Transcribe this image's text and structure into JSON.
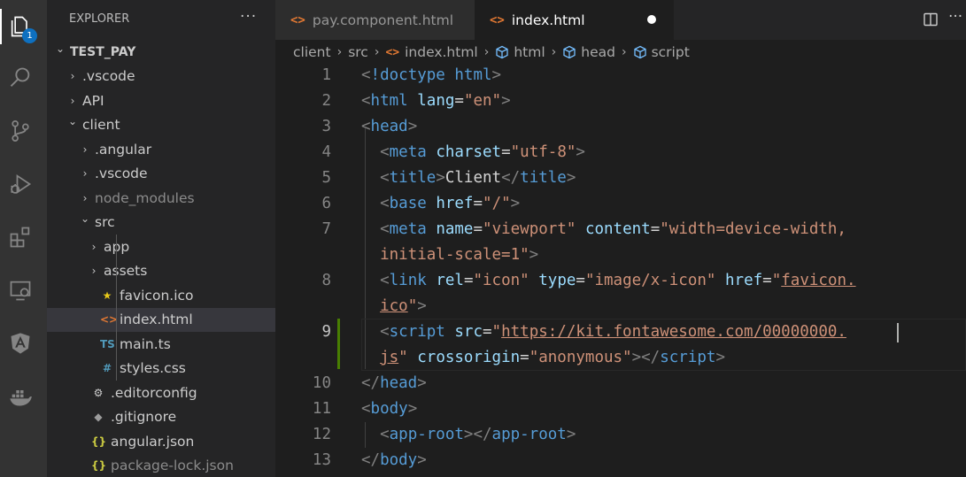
{
  "activity_bar": {
    "items": [
      {
        "name": "explorer-icon",
        "active": true
      },
      {
        "name": "search-icon"
      },
      {
        "name": "source-control-icon"
      },
      {
        "name": "run-debug-icon"
      },
      {
        "name": "extensions-icon"
      },
      {
        "name": "remote-explorer-icon"
      },
      {
        "name": "angular-icon"
      },
      {
        "name": "docker-icon"
      }
    ],
    "explorer_badge": "1"
  },
  "sidebar": {
    "title": "EXPLORER",
    "more_actions": "···",
    "tree": [
      {
        "label": "TEST_PAY",
        "chevron": "open",
        "indent": 0,
        "type": "root"
      },
      {
        "label": ".vscode",
        "chevron": "closed",
        "indent": 1,
        "type": "folder"
      },
      {
        "label": "API",
        "chevron": "closed",
        "indent": 1,
        "type": "folder"
      },
      {
        "label": "client",
        "chevron": "open",
        "indent": 1,
        "type": "folder"
      },
      {
        "label": ".angular",
        "chevron": "closed",
        "indent": 2,
        "type": "folder"
      },
      {
        "label": ".vscode",
        "chevron": "closed",
        "indent": 2,
        "type": "folder"
      },
      {
        "label": "node_modules",
        "chevron": "closed",
        "indent": 2,
        "type": "folder",
        "dim": true
      },
      {
        "label": "src",
        "chevron": "open",
        "indent": 2,
        "type": "folder"
      },
      {
        "label": "app",
        "chevron": "closed",
        "indent": 3,
        "type": "folder"
      },
      {
        "label": "assets",
        "chevron": "closed",
        "indent": 3,
        "type": "folder"
      },
      {
        "label": "favicon.ico",
        "indent": 3,
        "type": "file",
        "icon": "★",
        "icon_color": "#e8c91a"
      },
      {
        "label": "index.html",
        "indent": 3,
        "type": "file",
        "icon": "<>",
        "icon_color": "#e37933",
        "selected": true
      },
      {
        "label": "main.ts",
        "indent": 3,
        "type": "file",
        "icon": "TS",
        "icon_color": "#519aba"
      },
      {
        "label": "styles.css",
        "indent": 3,
        "type": "file",
        "icon": "#",
        "icon_color": "#519aba"
      },
      {
        "label": ".editorconfig",
        "indent": 2,
        "type": "file",
        "icon": "⚙",
        "icon_color": "#cccccc"
      },
      {
        "label": ".gitignore",
        "indent": 2,
        "type": "file",
        "icon": "◆",
        "icon_color": "#9b9b9b"
      },
      {
        "label": "angular.json",
        "indent": 2,
        "type": "file",
        "icon": "{}",
        "icon_color": "#cbcb41"
      },
      {
        "label": "package-lock.json",
        "indent": 2,
        "type": "file",
        "icon": "{}",
        "icon_color": "#cbcb41",
        "dim": true
      }
    ]
  },
  "tabs": [
    {
      "label": "pay.component.html",
      "icon": "<>",
      "active": false
    },
    {
      "label": "index.html",
      "icon": "<>",
      "active": true,
      "dirty": true
    }
  ],
  "breadcrumb": {
    "items": [
      "client",
      "src",
      "index.html",
      "html",
      "head",
      "script"
    ]
  },
  "editor": {
    "current_line": 9,
    "modified_line": 9,
    "lines": [
      {
        "n": "1",
        "tokens": [
          [
            "br",
            "<"
          ],
          [
            "tag",
            "!doctype"
          ],
          [
            "txt",
            " "
          ],
          [
            "tag",
            "html"
          ],
          [
            "br",
            ">"
          ]
        ]
      },
      {
        "n": "2",
        "tokens": [
          [
            "br",
            "<"
          ],
          [
            "tag",
            "html"
          ],
          [
            "txt",
            " "
          ],
          [
            "attr",
            "lang"
          ],
          [
            "txt",
            "="
          ],
          [
            "str",
            "\"en\""
          ],
          [
            "br",
            ">"
          ]
        ]
      },
      {
        "n": "3",
        "tokens": [
          [
            "br",
            "<"
          ],
          [
            "tag",
            "head"
          ],
          [
            "br",
            ">"
          ]
        ]
      },
      {
        "n": "4",
        "tokens": [
          [
            "txt",
            "  "
          ],
          [
            "br",
            "<"
          ],
          [
            "tag",
            "meta"
          ],
          [
            "txt",
            " "
          ],
          [
            "attr",
            "charset"
          ],
          [
            "txt",
            "="
          ],
          [
            "str",
            "\"utf-8\""
          ],
          [
            "br",
            ">"
          ]
        ]
      },
      {
        "n": "5",
        "tokens": [
          [
            "txt",
            "  "
          ],
          [
            "br",
            "<"
          ],
          [
            "tag",
            "title"
          ],
          [
            "br",
            ">"
          ],
          [
            "txt",
            "Client"
          ],
          [
            "br",
            "</"
          ],
          [
            "tag",
            "title"
          ],
          [
            "br",
            ">"
          ]
        ]
      },
      {
        "n": "6",
        "tokens": [
          [
            "txt",
            "  "
          ],
          [
            "br",
            "<"
          ],
          [
            "tag",
            "base"
          ],
          [
            "txt",
            " "
          ],
          [
            "attr",
            "href"
          ],
          [
            "txt",
            "="
          ],
          [
            "str",
            "\"/\""
          ],
          [
            "br",
            ">"
          ]
        ]
      },
      {
        "n": "7",
        "tokens": [
          [
            "txt",
            "  "
          ],
          [
            "br",
            "<"
          ],
          [
            "tag",
            "meta"
          ],
          [
            "txt",
            " "
          ],
          [
            "attr",
            "name"
          ],
          [
            "txt",
            "="
          ],
          [
            "str",
            "\"viewport\""
          ],
          [
            "txt",
            " "
          ],
          [
            "attr",
            "content"
          ],
          [
            "txt",
            "="
          ],
          [
            "str",
            "\"width=device-width,"
          ]
        ]
      },
      {
        "n": "",
        "tokens": [
          [
            "str",
            "  initial-scale=1\""
          ],
          [
            "br",
            ">"
          ]
        ]
      },
      {
        "n": "8",
        "tokens": [
          [
            "txt",
            "  "
          ],
          [
            "br",
            "<"
          ],
          [
            "tag",
            "link"
          ],
          [
            "txt",
            " "
          ],
          [
            "attr",
            "rel"
          ],
          [
            "txt",
            "="
          ],
          [
            "str",
            "\"icon\""
          ],
          [
            "txt",
            " "
          ],
          [
            "attr",
            "type"
          ],
          [
            "txt",
            "="
          ],
          [
            "str",
            "\"image/x-icon\""
          ],
          [
            "txt",
            " "
          ],
          [
            "attr",
            "href"
          ],
          [
            "txt",
            "="
          ],
          [
            "str",
            "\""
          ],
          [
            "strul",
            "favicon."
          ]
        ]
      },
      {
        "n": "",
        "tokens": [
          [
            "txt",
            "  "
          ],
          [
            "strul",
            "ico"
          ],
          [
            "str",
            "\""
          ],
          [
            "br",
            ">"
          ]
        ]
      },
      {
        "n": "9",
        "tokens": [
          [
            "txt",
            "  "
          ],
          [
            "br",
            "<"
          ],
          [
            "tag",
            "script"
          ],
          [
            "txt",
            " "
          ],
          [
            "attr",
            "src"
          ],
          [
            "txt",
            "="
          ],
          [
            "str",
            "\""
          ],
          [
            "strul",
            "https://kit.fontawesome.com/00000000."
          ]
        ]
      },
      {
        "n": "",
        "tokens": [
          [
            "txt",
            "  "
          ],
          [
            "strul",
            "js"
          ],
          [
            "str",
            "\""
          ],
          [
            "txt",
            " "
          ],
          [
            "attr",
            "crossorigin"
          ],
          [
            "txt",
            "="
          ],
          [
            "str",
            "\"anonymous\""
          ],
          [
            "br",
            "></"
          ],
          [
            "tag",
            "script"
          ],
          [
            "br",
            ">"
          ]
        ]
      },
      {
        "n": "10",
        "tokens": [
          [
            "br",
            "</"
          ],
          [
            "tag",
            "head"
          ],
          [
            "br",
            ">"
          ]
        ]
      },
      {
        "n": "11",
        "tokens": [
          [
            "br",
            "<"
          ],
          [
            "tag",
            "body"
          ],
          [
            "br",
            ">"
          ]
        ]
      },
      {
        "n": "12",
        "tokens": [
          [
            "txt",
            "  "
          ],
          [
            "br",
            "<"
          ],
          [
            "tag",
            "app-root"
          ],
          [
            "br",
            "></"
          ],
          [
            "tag",
            "app-root"
          ],
          [
            "br",
            ">"
          ]
        ]
      },
      {
        "n": "13",
        "tokens": [
          [
            "br",
            "</"
          ],
          [
            "tag",
            "body"
          ],
          [
            "br",
            ">"
          ]
        ]
      }
    ]
  },
  "colors": {
    "tag": "#569cd6",
    "attribute": "#9cdcfe",
    "string": "#ce9178",
    "bracket": "#808080",
    "text": "#d4d4d4",
    "modified_gutter": "#487e02",
    "badge": "#0e70c0",
    "html_icon": "#e37933"
  }
}
